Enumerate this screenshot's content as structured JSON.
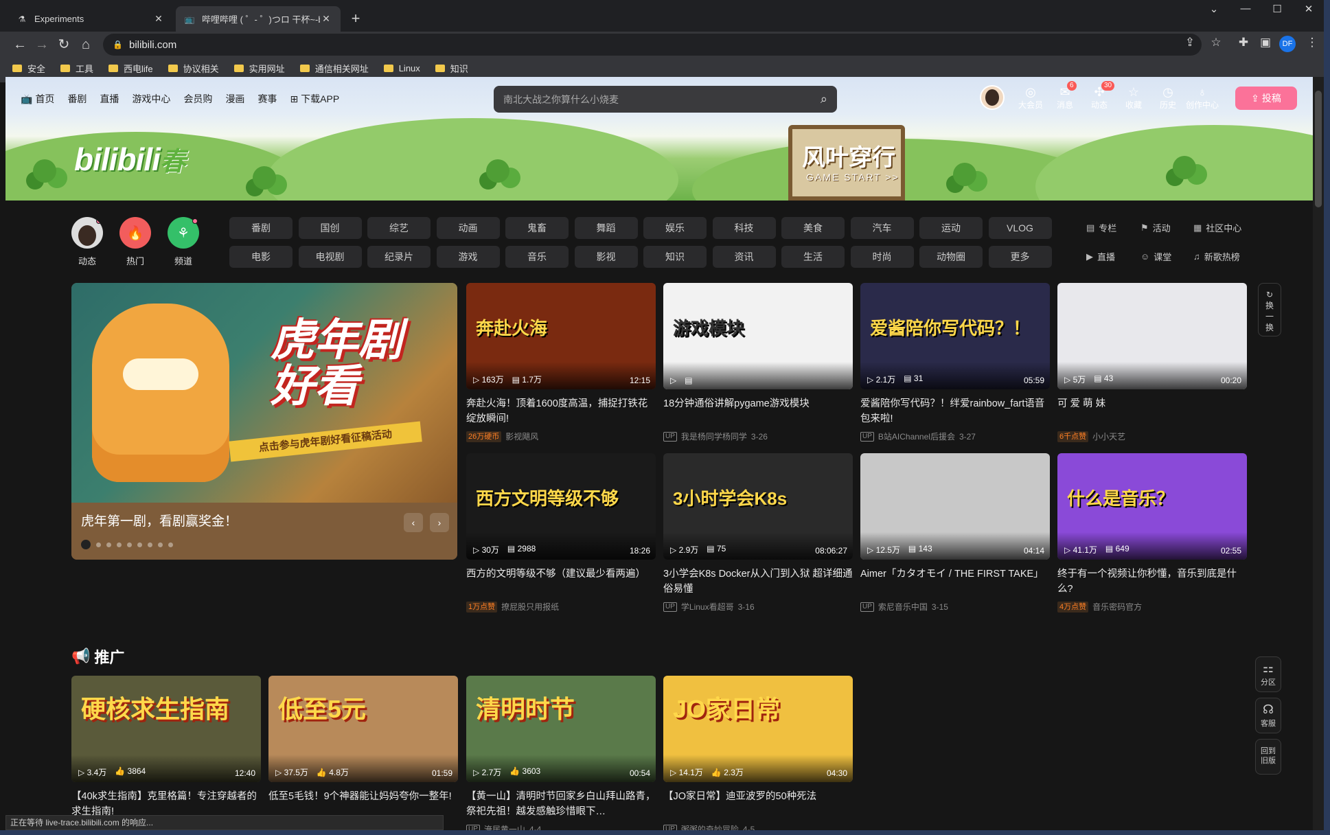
{
  "browser": {
    "tabs": [
      {
        "title": "Experiments",
        "icon": "flask-icon"
      },
      {
        "title": "哔哩哔哩 ( ゜- ゜)つロ 干杯~-bilibili",
        "icon": "bilibili-tv-icon"
      }
    ],
    "url": "bilibili.com",
    "bookmarks": [
      "安全",
      "工具",
      "西电life",
      "协议相关",
      "实用网址",
      "通信相关网址",
      "Linux",
      "知识"
    ],
    "profile_initials": "DF",
    "status_text": "正在等待 live-trace.bilibili.com 的响应..."
  },
  "header": {
    "nav": [
      "首页",
      "番剧",
      "直播",
      "游戏中心",
      "会员购",
      "漫画",
      "赛事",
      "下载APP"
    ],
    "search_placeholder": "南北大战之你算什么小烧麦",
    "right_icons": [
      {
        "label": "大会员",
        "icon": "vip-icon",
        "badge": ""
      },
      {
        "label": "消息",
        "icon": "message-icon",
        "badge": "6"
      },
      {
        "label": "动态",
        "icon": "dynamic-icon",
        "badge": "30"
      },
      {
        "label": "收藏",
        "icon": "star-icon",
        "badge": ""
      },
      {
        "label": "历史",
        "icon": "history-icon",
        "badge": ""
      },
      {
        "label": "创作中心",
        "icon": "bulb-icon",
        "badge": ""
      }
    ],
    "upload_label": "投稿",
    "banner_sign_title": "风叶穿行",
    "banner_sign_sub": "GAME START >>",
    "logo_text": "bilibili",
    "logo_suffix": "春"
  },
  "channels": {
    "left": [
      {
        "label": "动态",
        "color": "#f0f0f0"
      },
      {
        "label": "热门",
        "color": "#f25d5d"
      },
      {
        "label": "频道",
        "color": "#34c069"
      }
    ],
    "row1": [
      "番剧",
      "国创",
      "综艺",
      "动画",
      "鬼畜",
      "舞蹈",
      "娱乐",
      "科技",
      "美食",
      "汽车",
      "运动",
      "VLOG"
    ],
    "row2": [
      "电影",
      "电视剧",
      "纪录片",
      "游戏",
      "音乐",
      "影视",
      "知识",
      "资讯",
      "生活",
      "时尚",
      "动物圈",
      "更多"
    ],
    "side": [
      {
        "label": "专栏",
        "icon": "article-icon"
      },
      {
        "label": "活动",
        "icon": "flag-icon"
      },
      {
        "label": "社区中心",
        "icon": "community-icon"
      },
      {
        "label": "直播",
        "icon": "live-icon"
      },
      {
        "label": "课堂",
        "icon": "classroom-icon"
      },
      {
        "label": "新歌热榜",
        "icon": "music-chart-icon"
      }
    ]
  },
  "carousel": {
    "headline": "虎年剧好看",
    "subline": "点击参与虎年剧好看征稿活动",
    "caption": "虎年第一剧，看剧赢奖金！",
    "dot_count": 9,
    "active_dot": 0
  },
  "refresh_label": "换一换",
  "videos": [
    {
      "thumb_text": "奔赴火海",
      "plays": "163万",
      "danmaku": "1.7万",
      "duration": "12:15",
      "title": "奔赴火海！顶着1600度高温，捕捉打铁花绽放瞬间!",
      "tag": "26万硬币",
      "author": "影视飓风",
      "date": "",
      "bg": "#7a2a10"
    },
    {
      "thumb_text": "游戏模块",
      "plays": "",
      "danmaku": "",
      "duration": "",
      "title": "18分钟通俗讲解pygame游戏模块",
      "tag": "",
      "author": "我是杨同学杨同学",
      "date": "3-26",
      "bg": "#f2f2f2"
    },
    {
      "thumb_text": "爱酱陪你写代码？！",
      "plays": "2.1万",
      "danmaku": "31",
      "duration": "05:59",
      "title": "爱酱陪你写代码？！绊爱rainbow_fart语音包来啦!",
      "tag": "",
      "author": "B站AIChannel后援会",
      "date": "3-27",
      "bg": "#2a2a4a"
    },
    {
      "thumb_text": "",
      "plays": "5万",
      "danmaku": "43",
      "duration": "00:20",
      "title": "可 爱 萌 妹",
      "tag": "6千点赞",
      "author": "小小天艺",
      "date": "",
      "bg": "#e8e8ec"
    },
    {
      "thumb_text": "西方文明等级不够",
      "plays": "30万",
      "danmaku": "2988",
      "duration": "18:26",
      "title": "西方的文明等级不够（建议最少看两遍）",
      "tag": "1万点赞",
      "author": "撩屁股只用报纸",
      "date": "",
      "bg": "#1a1a1a"
    },
    {
      "thumb_text": "3小时学会K8s",
      "plays": "2.9万",
      "danmaku": "75",
      "duration": "08:06:27",
      "title": "3小学会K8s Docker从入门到入狱 超详细通俗易懂",
      "tag": "",
      "author": "学Linux看超哥",
      "date": "3-16",
      "bg": "#2a2a2a"
    },
    {
      "thumb_text": "",
      "plays": "12.5万",
      "danmaku": "143",
      "duration": "04:14",
      "title": "Aimer「カタオモイ / THE FIRST TAKE」",
      "tag": "",
      "author": "索尼音乐中国",
      "date": "3-15",
      "bg": "#c8c8c8"
    },
    {
      "thumb_text": "什么是音乐？",
      "plays": "41.1万",
      "danmaku": "649",
      "duration": "02:55",
      "title": "终于有一个视频让你秒懂，音乐到底是什么?",
      "tag": "4万点赞",
      "author": "音乐密码官方",
      "date": "",
      "bg": "#8a4ad8"
    }
  ],
  "promo": {
    "heading": "推广",
    "items": [
      {
        "thumb_text": "硬核求生指南",
        "plays": "3.4万",
        "likes": "3864",
        "duration": "12:40",
        "title": "【40k求生指南】克里格篇！专注穿越者的求生指南!",
        "bg": "#5a5a3a"
      },
      {
        "thumb_text": "低至5元",
        "plays": "37.5万",
        "likes": "4.8万",
        "duration": "01:59",
        "title": "低至5毛钱！9个神器能让妈妈夸你一整年!",
        "bg": "#b88a5a"
      },
      {
        "thumb_text": "清明时节",
        "plays": "2.7万",
        "likes": "3603",
        "duration": "00:54",
        "title": "【黄一山】清明时节回家乡白山拜山路青，祭祀先祖！越发感触珍惜眼下…",
        "bg": "#5a7a4a"
      },
      {
        "thumb_text": "JO家日常",
        "plays": "14.1万",
        "likes": "2.3万",
        "duration": "04:30",
        "title": "【JO家日常】迪亚波罗的50种死法",
        "bg": "#f0c040"
      }
    ],
    "authors": [
      "",
      "",
      "淹居黄一山",
      "粥粥的奇妙冒险"
    ],
    "dates": [
      "",
      "",
      "4-4",
      "4-5"
    ]
  },
  "float_buttons": [
    {
      "label": "分区",
      "icon": "grid-icon"
    },
    {
      "label": "客服",
      "icon": "headset-icon"
    },
    {
      "label": "回到旧版",
      "icon": ""
    }
  ]
}
